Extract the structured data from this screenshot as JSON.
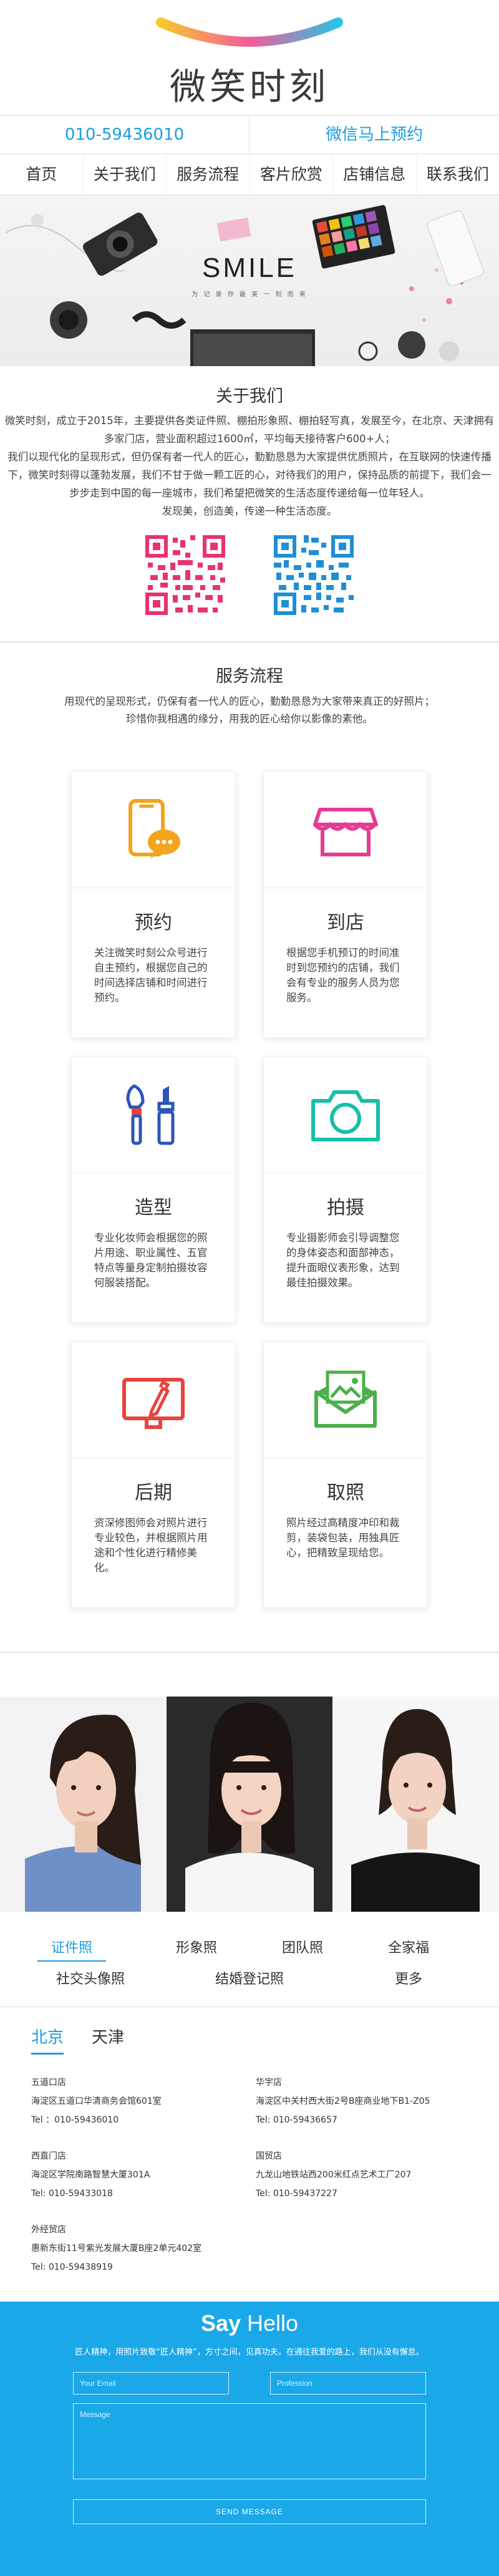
{
  "brand": {
    "logo_text": "微笑时刻",
    "arc_colors": [
      "#f7c82e",
      "#f45b9b",
      "#29c3e5"
    ]
  },
  "contact": {
    "phone": "010-59436010",
    "wechat": "微信马上预约"
  },
  "nav": {
    "items": [
      "首页",
      "关于我们",
      "服务流程",
      "客片欣赏",
      "店铺信息",
      "联系我们"
    ]
  },
  "banner": {
    "headline": "SMILE",
    "subline": "为 记 录 你 最 美 一 刻 而 来"
  },
  "about": {
    "title": "关于我们",
    "paragraphs": [
      "微笑时刻，成立于2015年，主要提供各类证件照、棚拍形象照、棚拍轻写真，发展至今，在北京、天津拥有多家门店，营业面积超过1600㎡，平均每天接待客户600+人；",
      "我们以现代化的呈现形式，但仍保有者一代人的匠心，勤勤恳恳为大家提供优质照片，在互联网的快速传播下，微笑时刻得以蓬勃发展，我们不甘于做一颗工匠的心，对待我们的用户，保持品质的前提下，我们会一步步走到中国的每一座城市，我们希望把微笑的生活态度传递给每一位年轻人。",
      "发现美，创造美，传递一种生活态度。"
    ]
  },
  "services": {
    "title": "服务流程",
    "intro": [
      "用现代的呈现形式，仍保有者一代人的匠心，勤勤恳恳为大家带来真正的好照片；",
      "珍惜你我相遇的缘分，用我的匠心给你以影像的素他。"
    ],
    "cards": [
      {
        "name": "预约",
        "icon": "phone-chat-icon",
        "color": "#f4a31c",
        "desc": "关注微笑时刻公众号进行自主预约，根据您自己的时间选择店铺和时间进行预约。"
      },
      {
        "name": "到店",
        "icon": "storefront-icon",
        "color": "#e73a93",
        "desc": "根据您手机预订的时间准时到您预约的店铺，我们会有专业的服务人员为您服务。"
      },
      {
        "name": "造型",
        "icon": "makeup-brush-icon",
        "color": "#2b55b6",
        "desc": "专业化妆师会根据您的照片用途、职业属性、五官特点等量身定制拍摄妆容何服装搭配。"
      },
      {
        "name": "拍摄",
        "icon": "camera-icon",
        "color": "#16bfa6",
        "desc": "专业摄影师会引导调整您的身体姿态和面部神态，提升面眼仪表形象，达到最佳拍摄效果。"
      },
      {
        "name": "后期",
        "icon": "monitor-pen-icon",
        "color": "#e8443e",
        "desc": "资深修图师会对照片进行专业较色，并根据照片用途和个性化进行精修美化。"
      },
      {
        "name": "取照",
        "icon": "photo-envelope-icon",
        "color": "#4bb04a",
        "desc": "照片经过高精度冲印和裁剪，装袋包装，用独具匠心，把精致呈现给您。"
      }
    ]
  },
  "gallery": {
    "tabs": [
      "证件照",
      "形象照",
      "团队照",
      "全家福",
      "社交头像照",
      "结婚登记照",
      "更多"
    ],
    "active_tab": "证件照"
  },
  "stores": {
    "cities": [
      "北京",
      "天津"
    ],
    "active_city": "北京",
    "list": [
      {
        "name": "五道口店",
        "address": "海淀区五道口华清商务会馆601室",
        "tel": "Tel ：010-59436010"
      },
      {
        "name": "华宇店",
        "address": "海淀区中关村西大街2号B座商业地下B1-Z05",
        "tel": "Tel: 010-59436657"
      },
      {
        "name": "西直门店",
        "address": "海淀区学院南路智慧大厦301A",
        "tel": "Tel: 010-59433018"
      },
      {
        "name": "国贸店",
        "address": "九龙山地铁站西200米红点艺术工厂207",
        "tel": "Tel: 010-59437227"
      },
      {
        "name": "外经贸店",
        "address": "惠新东街11号紫光发展大厦B座2单元402室",
        "tel": "Tel: 010-59438919"
      }
    ]
  },
  "hello": {
    "title_bold": "Say",
    "title_light": "Hello",
    "subtitle": "匠人精神，用照片致敬“匠人精神”，方寸之间，见真功夫。在通往我爱的路上，我们从没有懈怠。",
    "email_placeholder": "Your Email",
    "profession_placeholder": "Profession",
    "message_placeholder": "Message",
    "send_label": "SEND MESSAGE"
  }
}
